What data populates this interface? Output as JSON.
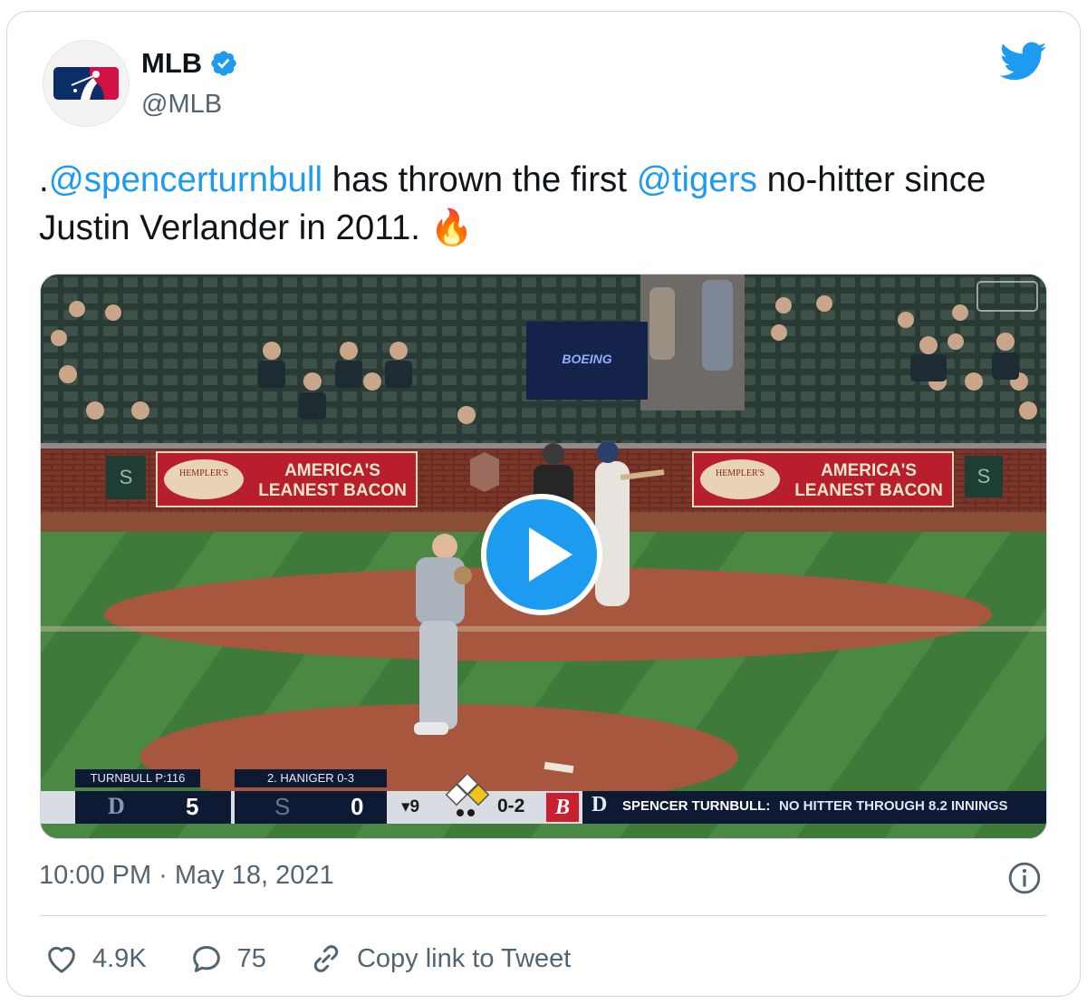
{
  "account": {
    "name": "MLB",
    "handle": "@MLB",
    "verified": true
  },
  "tweet": {
    "prefix": ".",
    "mention1": "@spencerturnbull",
    "middle": " has thrown the first ",
    "mention2": "@tigers",
    "suffix": " no-hitter since Justin Verlander in 2011. ",
    "emoji": "🔥",
    "timestamp": "10:00 PM · May 18, 2021"
  },
  "video": {
    "billboard": "AMERICA'S LEANEST BACON",
    "billboard_line1": "AMERICA'S",
    "billboard_line2": "LEANEST BACON",
    "billboard_brand": "HEMPLER'S",
    "sponsor": "BOEING",
    "scorebug": {
      "pitcher_label": "TURNBULL  P:116",
      "batter_label": "2. HANIGER  0-3",
      "away_score": "5",
      "home_score": "0",
      "inning": "▾9",
      "count": "0-2",
      "banner_name": "SPENCER TURNBULL:",
      "banner_text": "NO HITTER THROUGH 8.2 INNINGS"
    }
  },
  "actions": {
    "likes": "4.9K",
    "replies": "75",
    "copy_link": "Copy link to Tweet"
  },
  "colors": {
    "link": "#1d9bf0",
    "secondary_text": "#536471",
    "play_button": "#1d9bf0"
  },
  "icons": [
    "mlb-logo-icon",
    "verified-badge-icon",
    "twitter-bird-icon",
    "play-icon",
    "info-icon",
    "heart-icon",
    "reply-icon",
    "link-icon"
  ]
}
